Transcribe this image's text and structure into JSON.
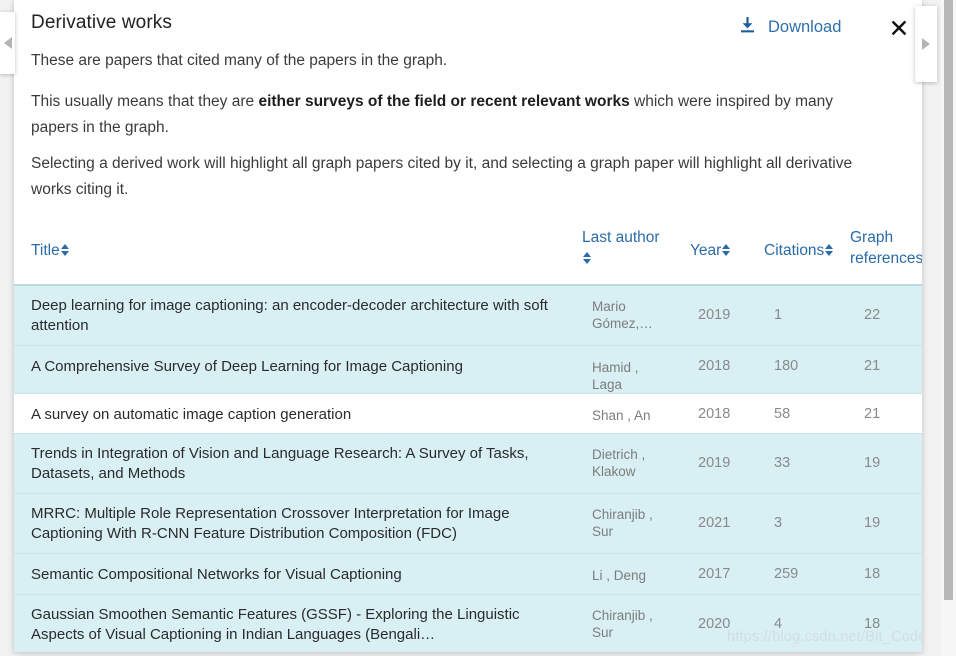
{
  "header": {
    "title": "Derivative works",
    "download_label": "Download",
    "download_icon": "download-arrow-icon",
    "close_icon": "close-x-icon"
  },
  "nav": {
    "left_arrow_icon": "chevron-left-icon",
    "right_arrow_icon": "chevron-right-icon"
  },
  "body_text": {
    "para_1": "These are papers that cited many of the papers in the graph.",
    "para_2_prefix": "This usually means that they are ",
    "para_2_bold": "either surveys of the field or recent relevant works",
    "para_2_suffix": " which were inspired by many papers in the graph.",
    "para_3": "Selecting a derived work will highlight all graph papers cited by it, and selecting a graph paper will highlight all derivative works citing it."
  },
  "table": {
    "columns": [
      {
        "label": "Title",
        "sort": "both"
      },
      {
        "label": "Last author",
        "sort": "both"
      },
      {
        "label": "Year",
        "sort": "both"
      },
      {
        "label": "Citations",
        "sort": "both"
      },
      {
        "label": "Graph references",
        "sort": "asc"
      }
    ],
    "rows": [
      {
        "title": "Deep learning for image captioning: an encoder-decoder architecture with soft attention",
        "last_author": "Mario Gómez,…",
        "year": "2019",
        "citations": "1",
        "graph_references": "22"
      },
      {
        "title": "A Comprehensive Survey of Deep Learning for Image Captioning",
        "last_author": "Hamid , Laga",
        "year": "2018",
        "citations": "180",
        "graph_references": "21"
      },
      {
        "title": "A survey on automatic image caption generation",
        "last_author": "Shan , An",
        "year": "2018",
        "citations": "58",
        "graph_references": "21"
      },
      {
        "title": "Trends in Integration of Vision and Language Research: A Survey of Tasks, Datasets, and Methods",
        "last_author": "Dietrich , Klakow",
        "year": "2019",
        "citations": "33",
        "graph_references": "19"
      },
      {
        "title": "MRRC: Multiple Role Representation Crossover Interpretation for Image Captioning With R-CNN Feature Distribution Composition (FDC)",
        "last_author": "Chiranjib , Sur",
        "year": "2021",
        "citations": "3",
        "graph_references": "19"
      },
      {
        "title": "Semantic Compositional Networks for Visual Captioning",
        "last_author": "Li , Deng",
        "year": "2017",
        "citations": "259",
        "graph_references": "18"
      },
      {
        "title": "Gaussian Smoothen Semantic Features (GSSF) - Exploring the Linguistic Aspects of Visual Captioning in Indian Languages (Bengali…",
        "last_author": "Chiranjib , Sur",
        "year": "2020",
        "citations": "4",
        "graph_references": "18"
      }
    ]
  },
  "watermark": "https://blog.csdn.net/Bit_Coders",
  "colors": {
    "link": "#2f6fad",
    "header_text": "#2b6ca8",
    "row_shaded": "#d8eff4",
    "row_plain": "#ffffff",
    "row_border": "#c9e3ea"
  }
}
